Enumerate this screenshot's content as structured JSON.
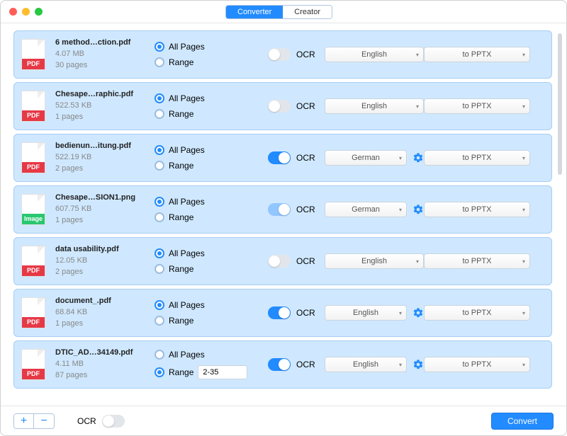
{
  "tabs": {
    "converter": "Converter",
    "creator": "Creator",
    "active": 0
  },
  "labels": {
    "all_pages": "All Pages",
    "range": "Range",
    "ocr": "OCR",
    "to_pptx": "to PPTX"
  },
  "footer": {
    "ocr_label": "OCR",
    "convert": "Convert",
    "plus": "+",
    "minus": "−"
  },
  "files": [
    {
      "type": "pdf",
      "name": "6 method…ction.pdf",
      "size": "4.07 MB",
      "pages": "30 pages",
      "pg_mode": "all",
      "range": "",
      "ocr": false,
      "ocr_faded": false,
      "lang": "English",
      "gear": false
    },
    {
      "type": "pdf",
      "name": "Chesape…raphic.pdf",
      "size": "522.53 KB",
      "pages": "1 pages",
      "pg_mode": "all",
      "range": "",
      "ocr": false,
      "ocr_faded": false,
      "lang": "English",
      "gear": false
    },
    {
      "type": "pdf",
      "name": "bedienun…itung.pdf",
      "size": "522.19 KB",
      "pages": "2 pages",
      "pg_mode": "all",
      "range": "",
      "ocr": true,
      "ocr_faded": false,
      "lang": "German",
      "gear": true
    },
    {
      "type": "image",
      "name": "Chesape…SION1.png",
      "size": "607.75 KB",
      "pages": "1 pages",
      "pg_mode": "all",
      "range": "",
      "ocr": true,
      "ocr_faded": true,
      "lang": "German",
      "gear": true
    },
    {
      "type": "pdf",
      "name": "data usability.pdf",
      "size": "12.05 KB",
      "pages": "2 pages",
      "pg_mode": "all",
      "range": "",
      "ocr": false,
      "ocr_faded": false,
      "lang": "English",
      "gear": false
    },
    {
      "type": "pdf",
      "name": "document_.pdf",
      "size": "68.84 KB",
      "pages": "1 pages",
      "pg_mode": "all",
      "range": "",
      "ocr": true,
      "ocr_faded": false,
      "lang": "English",
      "gear": true
    },
    {
      "type": "pdf",
      "name": "DTIC_AD…34149.pdf",
      "size": "4.11 MB",
      "pages": "87 pages",
      "pg_mode": "range",
      "range": "2-35",
      "ocr": true,
      "ocr_faded": false,
      "lang": "English",
      "gear": true
    }
  ]
}
